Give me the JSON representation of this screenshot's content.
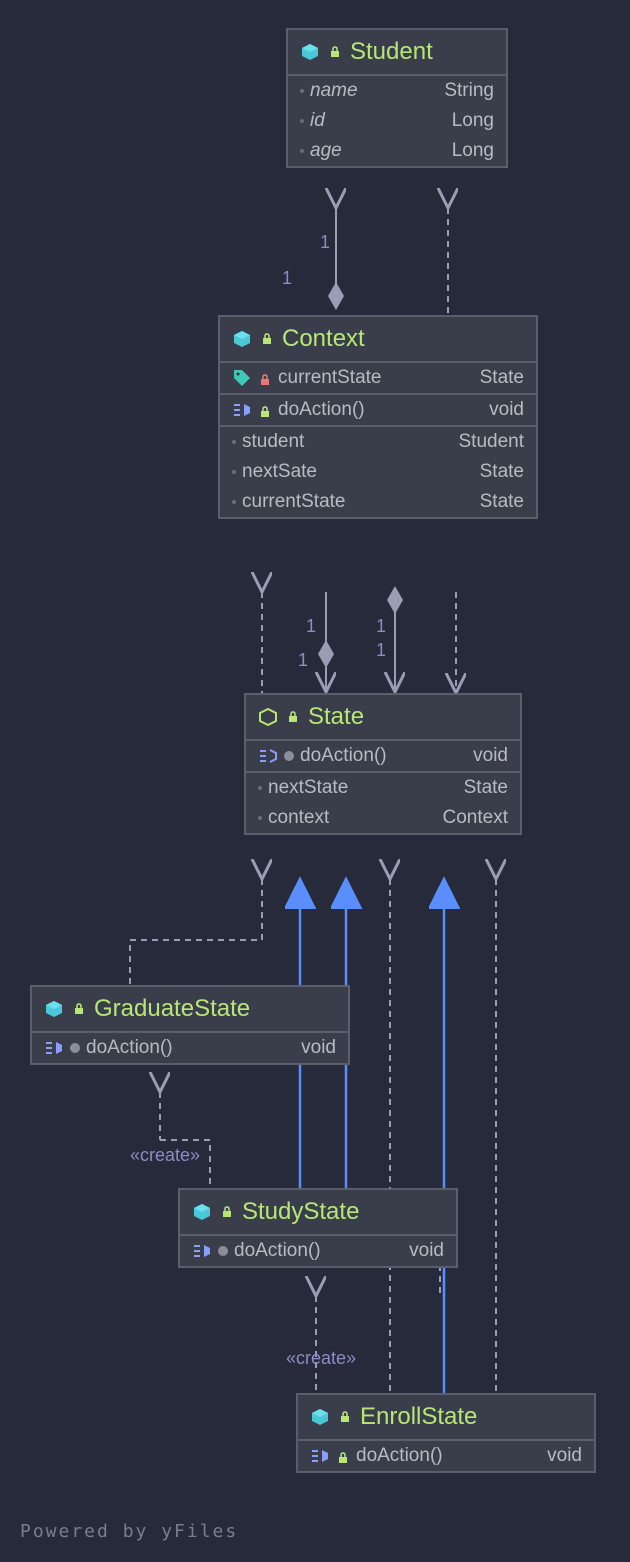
{
  "classes": {
    "student": {
      "name": "Student",
      "fields": [
        {
          "name": "name",
          "type": "String",
          "italic": true
        },
        {
          "name": "id",
          "type": "Long",
          "italic": true
        },
        {
          "name": "age",
          "type": "Long",
          "italic": true
        }
      ]
    },
    "context": {
      "name": "Context",
      "properties": [
        {
          "name": "currentState",
          "type": "State",
          "icon": "tag",
          "lock": "red"
        }
      ],
      "methods": [
        {
          "name": "doAction()",
          "type": "void",
          "lock": "green"
        }
      ],
      "fields": [
        {
          "name": "student",
          "type": "Student"
        },
        {
          "name": "nextSate",
          "type": "State"
        },
        {
          "name": "currentState",
          "type": "State"
        }
      ]
    },
    "state": {
      "name": "State",
      "methods": [
        {
          "name": "doAction()",
          "type": "void",
          "vis": "circle"
        }
      ],
      "fields": [
        {
          "name": "nextState",
          "type": "State"
        },
        {
          "name": "context",
          "type": "Context"
        }
      ]
    },
    "graduateState": {
      "name": "GraduateState",
      "methods": [
        {
          "name": "doAction()",
          "type": "void",
          "vis": "circle"
        }
      ]
    },
    "studyState": {
      "name": "StudyState",
      "methods": [
        {
          "name": "doAction()",
          "type": "void",
          "vis": "circle"
        }
      ]
    },
    "enrollState": {
      "name": "EnrollState",
      "methods": [
        {
          "name": "doAction()",
          "type": "void",
          "lock": "green"
        }
      ]
    }
  },
  "edgeLabels": {
    "create1": "«create»",
    "create2": "«create»",
    "one": "1"
  },
  "footer": "Powered by yFiles"
}
